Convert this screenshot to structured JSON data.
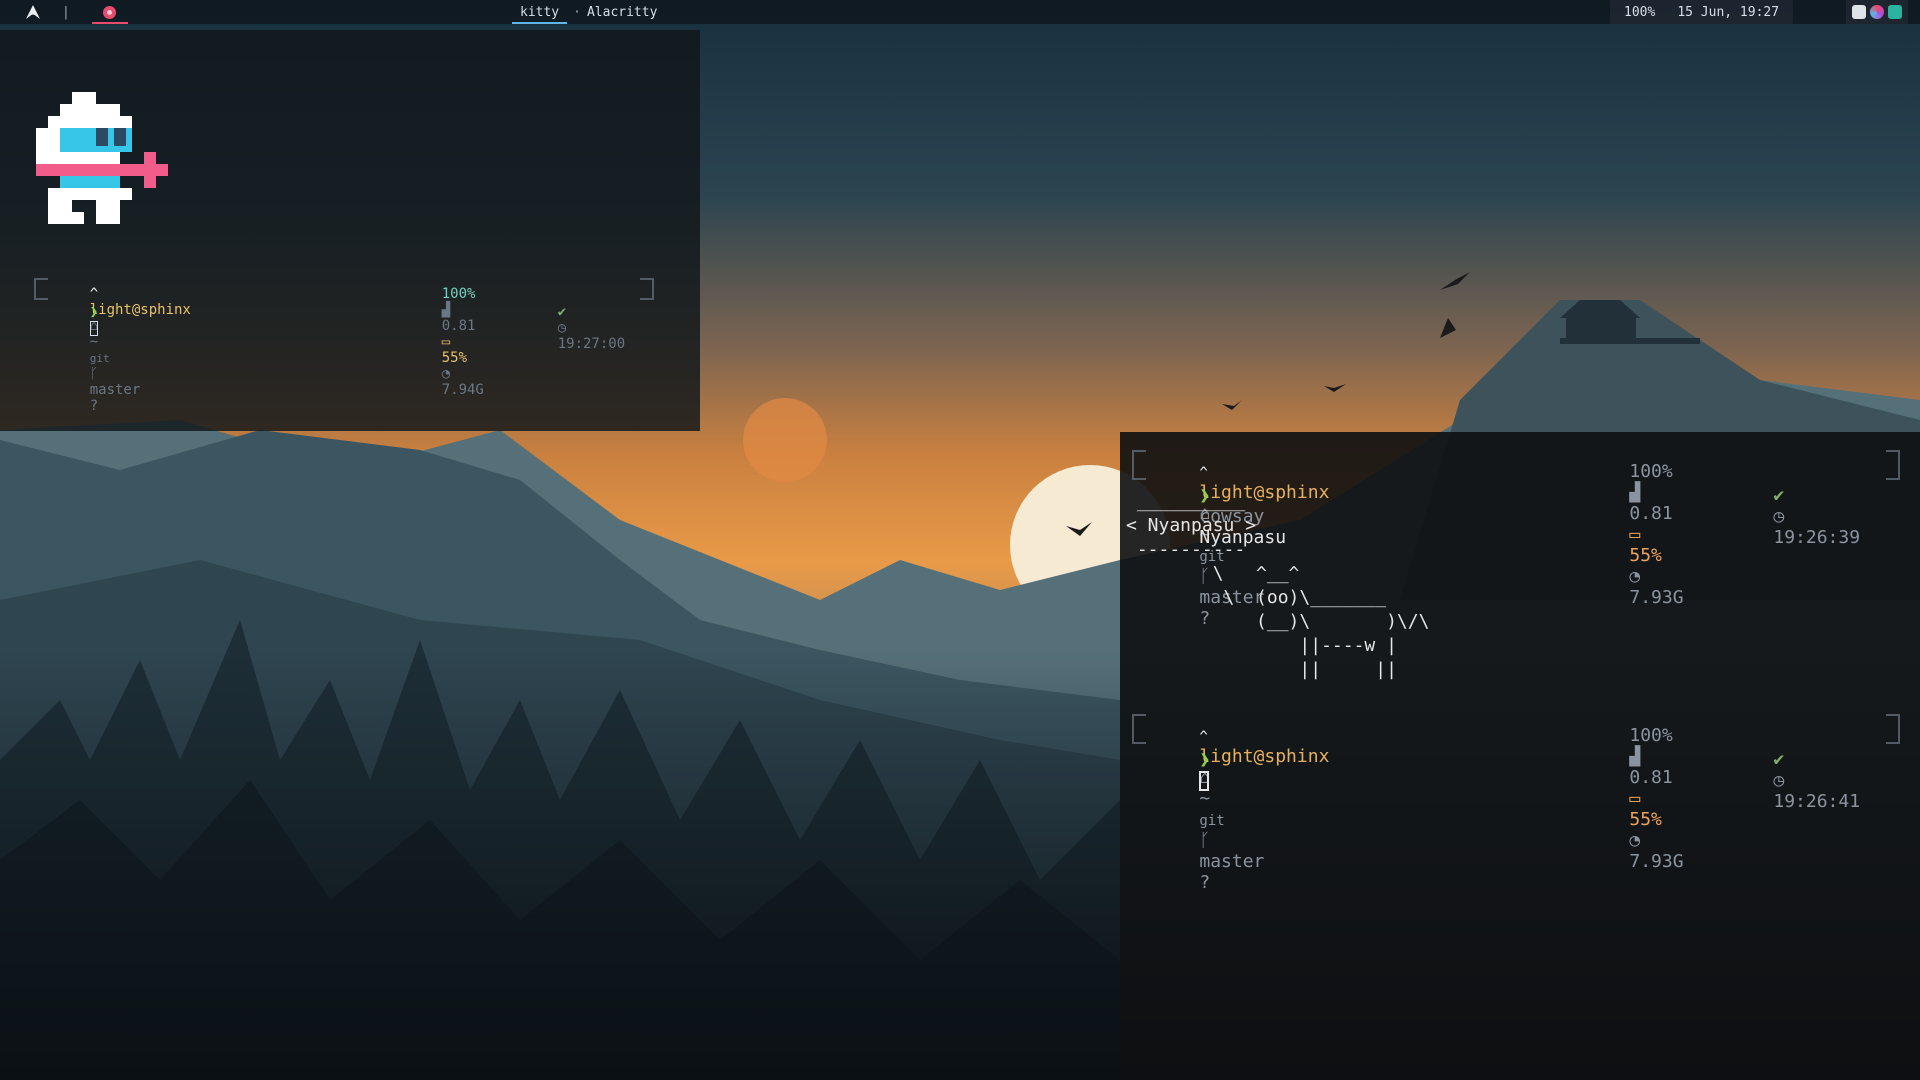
{
  "topbar": {
    "logo_icon": "arch-logo-icon",
    "separator": "|",
    "workspace_icon": "vivaldi-icon",
    "windows": [
      "kitty",
      "Alacritty"
    ],
    "window_sep": "·",
    "battery": "100%",
    "datetime": "15 Jun, 19:27",
    "tray_icons": [
      "discord-icon",
      "color-picker-icon",
      "terminal-icon"
    ]
  },
  "kitty": {
    "prompt": {
      "caret": "^",
      "user": "light@sphinx",
      "home": "~",
      "git": "git",
      "branch": "master",
      "battery": "100%",
      "load": "0.81",
      "disk": "55%",
      "mem": "7.94G",
      "check": "✔",
      "time": "19:27:00",
      "arrow": "❯"
    }
  },
  "alacritty": {
    "prompt1": {
      "caret": "^",
      "user": "light@sphinx",
      "home": "~",
      "git": "git",
      "branch": "master",
      "battery": "100%",
      "load": "0.81",
      "disk": "55%",
      "mem": "7.93G",
      "check": "✔",
      "time": "19:26:39",
      "arrow": "❯",
      "command": "cowsay",
      "argument": "Nyanpasu"
    },
    "cowsay_output": " __________\n< Nyanpasu >\n ----------\n        \\   ^__^\n         \\  (oo)\\_______\n            (__)\\       )\\/\\\n                ||----w |\n                ||     ||",
    "prompt2": {
      "caret": "^",
      "user": "light@sphinx",
      "home": "~",
      "git": "git",
      "branch": "master",
      "battery": "100%",
      "load": "0.81",
      "disk": "55%",
      "mem": "7.93G",
      "check": "✔",
      "time": "19:26:41",
      "arrow": "❯"
    }
  },
  "colors": {
    "accent_red": "#e84b6b",
    "accent_blue": "#5fb4e8",
    "prompt_user": "#e8b15f",
    "prompt_arrow": "#8fd14f"
  }
}
